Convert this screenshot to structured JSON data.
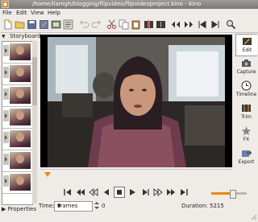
{
  "window": {
    "title": "/home/liamgh/blogging/flipvideo/flipvideoproject.kino - Kino"
  },
  "menu": [
    "File",
    "Edit",
    "View",
    "Help"
  ],
  "toolbar": [
    "new-file-icon",
    "open-folder-icon",
    "save-icon",
    "save-as-icon",
    "export-frame-icon",
    "properties-icon",
    "undo-icon",
    "redo-icon",
    "cut-icon",
    "copy-icon",
    "paste-icon",
    "split-scene-icon",
    "join-scenes-icon",
    "zoom-icon"
  ],
  "storyboard": {
    "label": "Storyboard",
    "properties_label": "Properties"
  },
  "sidebar": {
    "items": [
      {
        "label": "Edit",
        "icon": "edit-icon"
      },
      {
        "label": "Capture",
        "icon": "capture-icon"
      },
      {
        "label": "Timeline",
        "icon": "timeline-icon"
      },
      {
        "label": "Trim",
        "icon": "trim-icon"
      },
      {
        "label": "FX",
        "icon": "fx-icon"
      },
      {
        "label": "Export",
        "icon": "export-icon"
      }
    ]
  },
  "status": {
    "time_label": "Time:",
    "time_format": "Frames",
    "frame_value": "0",
    "duration": "Duration: 5215"
  },
  "volume_level": 0.6,
  "colors": {
    "accent": "#e78a12",
    "titlebar": "#8a8a86",
    "window": "#efebe7"
  }
}
